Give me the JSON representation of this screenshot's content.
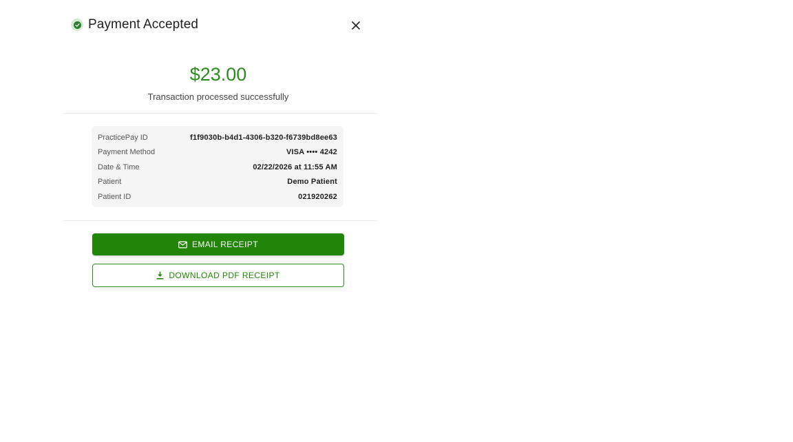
{
  "header": {
    "title": "Payment Accepted",
    "status_icon": "check-circle-icon",
    "close_icon": "close-icon"
  },
  "summary": {
    "amount": "$23.00",
    "message": "Transaction processed successfully"
  },
  "details": [
    {
      "label": "PracticePay ID",
      "value": "f1f9030b-b4d1-4306-b320-f6739bd8ee63"
    },
    {
      "label": "Payment Method",
      "value": "VISA •••• 4242"
    },
    {
      "label": "Date & Time",
      "value": "02/22/2026 at 11:55 AM"
    },
    {
      "label": "Patient",
      "value": "Demo Patient"
    },
    {
      "label": "Patient ID",
      "value": "021920262"
    }
  ],
  "actions": {
    "email_label": "EMAIL RECEIPT",
    "email_icon": "mail-icon",
    "download_label": "DOWNLOAD PDF RECEIPT",
    "download_icon": "download-icon"
  },
  "colors": {
    "accent": "#228508",
    "amount": "#2e8b1f",
    "panel_bg": "#f5f5f5"
  }
}
